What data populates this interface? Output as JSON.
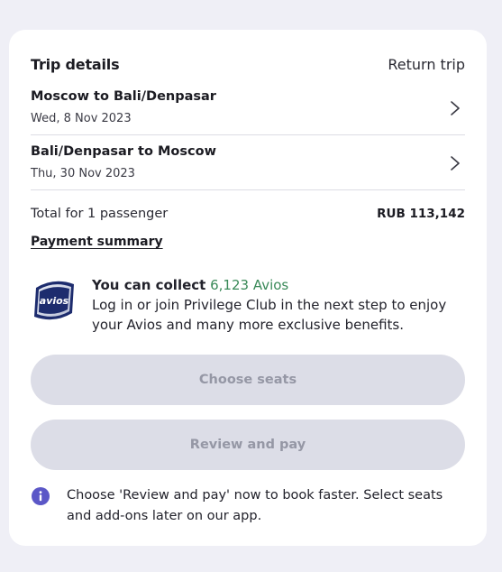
{
  "trip": {
    "title": "Trip details",
    "type": "Return trip"
  },
  "legs": [
    {
      "route": "Moscow to Bali/Denpasar",
      "date": "Wed, 8 Nov 2023"
    },
    {
      "route": "Bali/Denpasar to Moscow",
      "date": "Thu, 30 Nov 2023"
    }
  ],
  "total": {
    "label": "Total for 1 passenger",
    "price": "RUB 113,142"
  },
  "payment_summary_label": "Payment summary",
  "avios": {
    "logo_text": "avios",
    "headline_prefix": "You can collect",
    "amount": "6,123 Avios",
    "description": "Log in or join Privilege Club in the next step to enjoy your Avios and many more exclusive benefits."
  },
  "buttons": {
    "choose_seats": "Choose seats",
    "review_and_pay": "Review and pay"
  },
  "info": {
    "text": "Choose 'Review and pay' now to book faster. Select seats and add-ons later on our app."
  },
  "colors": {
    "background": "#efeff6",
    "card": "#ffffff",
    "avios_green": "#3a8a59",
    "disabled_button": "#dcdde7",
    "disabled_text": "#9597a5",
    "info_icon": "#5b57c7"
  }
}
